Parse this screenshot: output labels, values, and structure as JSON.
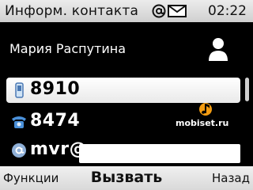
{
  "status_bar": {
    "title": "Информ. контакта",
    "time": "02:22",
    "icons": [
      "at-sign-icon",
      "envelope-icon"
    ]
  },
  "contact": {
    "name": "Мария Распутина",
    "avatar_icon": "person-icon"
  },
  "details": [
    {
      "icon": "mobile-phone-icon",
      "value": "8910",
      "selected": true
    },
    {
      "icon": "landline-phone-icon",
      "value": "8474",
      "selected": false
    },
    {
      "icon": "email-icon",
      "value": "mvr@",
      "selected": false
    }
  ],
  "watermark": {
    "text": "mobiset.ru"
  },
  "softkeys": {
    "left": "Функции",
    "center": "Вызвать",
    "right": "Назад"
  },
  "colors": {
    "background": "#000000",
    "bar": "#e0e0e0",
    "highlight": "#ffffff",
    "accent": "#f39c12"
  }
}
